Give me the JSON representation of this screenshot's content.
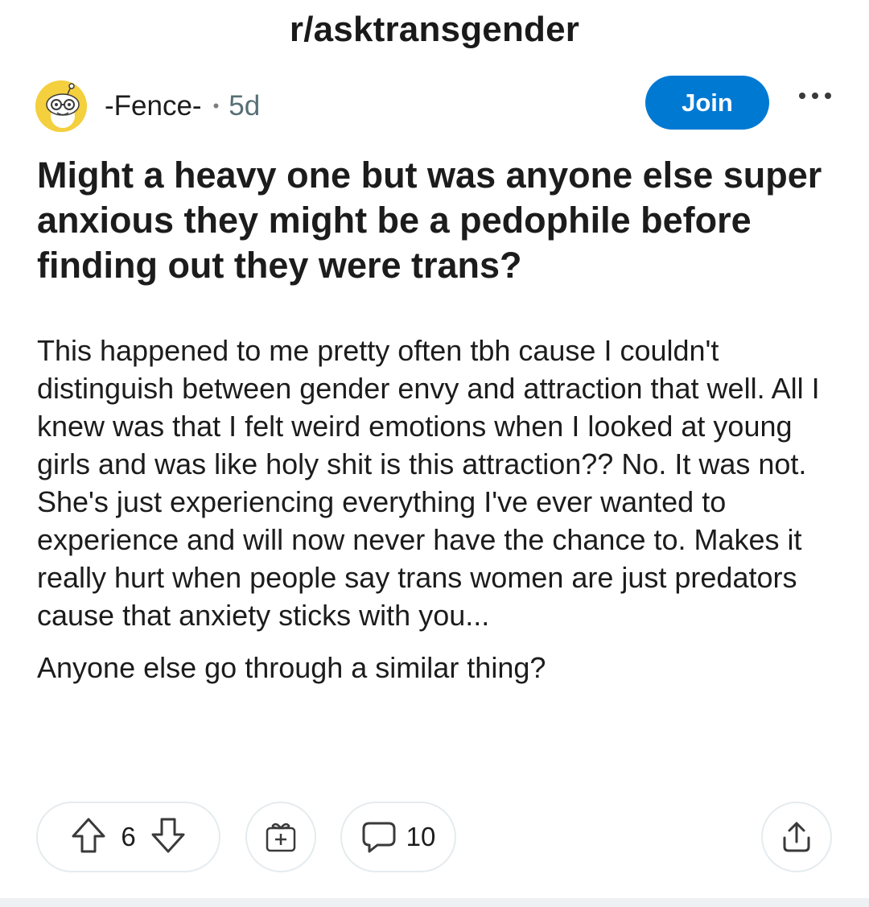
{
  "header": {
    "subreddit": "r/asktransgender"
  },
  "post": {
    "author": "-Fence-",
    "separator": "•",
    "age": "5d",
    "join_label": "Join",
    "more_label": "•••",
    "title": "Might a heavy one but was anyone else super anxious they might be a pedophile before finding out they were trans?",
    "body": [
      "This happened to me pretty often tbh cause I couldn't distinguish between gender envy and attraction that well. All I knew was that I felt weird emotions when I looked at young girls and was like holy shit is this attraction?? No. It was not. She's just experiencing everything I've ever wanted to experience and will now never have the chance to. Makes it really hurt when people say trans women are just predators cause that anxiety sticks with you...",
      "Anyone else go through a similar thing?"
    ]
  },
  "actions": {
    "vote_count": "6",
    "comment_count": "10",
    "icons": {
      "upvote": "arrow-up-icon",
      "downvote": "arrow-down-icon",
      "award": "gift-icon",
      "comment": "speech-bubble-icon",
      "share": "share-icon"
    }
  },
  "colors": {
    "accent": "#0079d3",
    "avatar": "#f4cf3e",
    "pill_border": "#e5ebee",
    "muted": "#576f76"
  }
}
